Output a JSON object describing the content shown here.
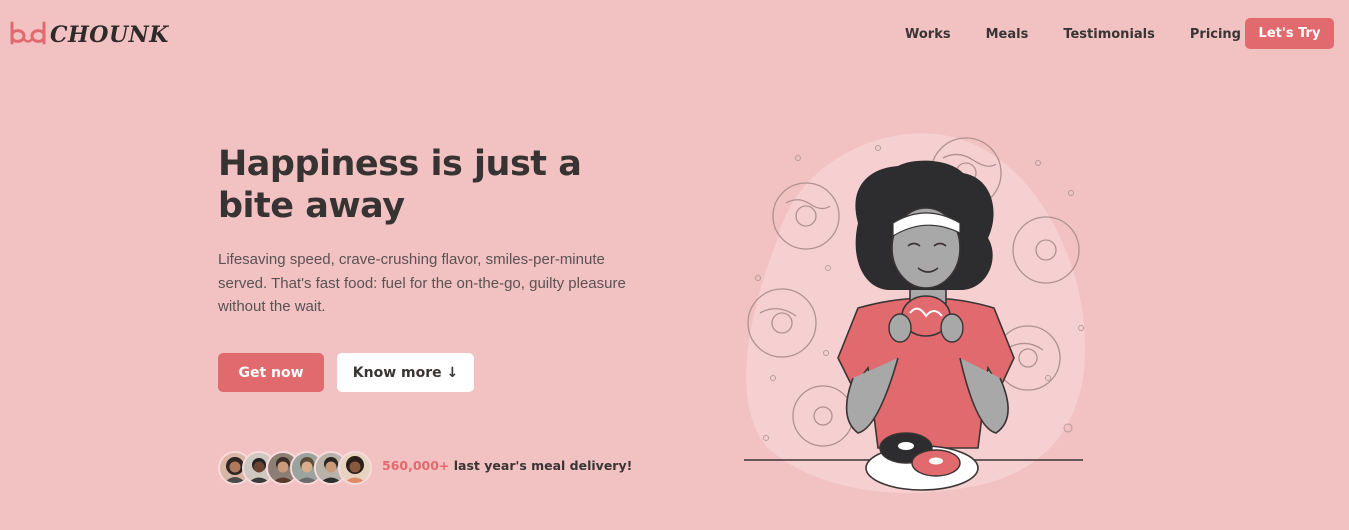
{
  "brand": {
    "name": "CHOUNK",
    "accent": "#e06a6d",
    "background": "#f2c2c2",
    "text": "#3a3434"
  },
  "nav": {
    "items": [
      "Works",
      "Meals",
      "Testimonials",
      "Pricing"
    ],
    "cta": "Let's Try"
  },
  "hero": {
    "title_line1": "Happiness is just a",
    "title_line2": "bite away",
    "description": "Lifesaving speed, crave-crushing flavor, smiles-per-minute served. That's fast food: fuel for the on-the-go, guilty pleasure without the wait.",
    "primary_button": "Get now",
    "secondary_button": "Know more ↓"
  },
  "stats": {
    "count": "560,000+",
    "label": " last year's meal delivery!",
    "avatars": [
      "customer-1",
      "customer-2",
      "customer-3",
      "customer-4",
      "customer-5",
      "customer-6"
    ]
  },
  "illustration": {
    "subject": "woman-eating-donut-icon"
  }
}
